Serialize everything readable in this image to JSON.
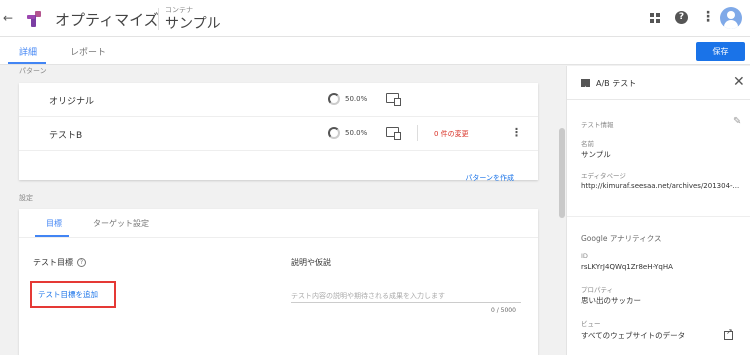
{
  "header": {
    "back_glyph": "←",
    "app_title": "オプティマイズ",
    "container_label": "コンテナ",
    "container_name": "サンプル"
  },
  "tabs": {
    "details": "詳細",
    "report": "レポート",
    "save": "保存"
  },
  "patterns": {
    "section_label": "パターン",
    "rows": [
      {
        "name": "オリジナル",
        "percent": "50.0%",
        "changes": ""
      },
      {
        "name": "テストB",
        "percent": "50.0%",
        "changes": "0 件の変更"
      }
    ],
    "create_link": "パターンを作成"
  },
  "settings": {
    "section_label": "設定",
    "tabs": [
      "目標",
      "ターゲット設定"
    ],
    "goal_heading": "テスト目標",
    "add_goal": "テスト目標を追加",
    "desc_heading": "説明や仮説",
    "desc_placeholder": "テスト内容の説明や期待される成果を入力します",
    "counter": "0 / 5000"
  },
  "side": {
    "title": "A/B テスト",
    "test_info_label": "テスト情報",
    "name_label": "名前",
    "name_value": "サンプル",
    "editor_label": "エディタページ",
    "editor_value": "http://kimuraf.seesaa.net/archives/201304-...",
    "ga_label": "Google アナリティクス",
    "id_label": "ID",
    "id_value": "rsLKYrJ4QWq1Zr8eH-YqHA",
    "property_label": "プロパティ",
    "property_value": "思い出のサッカー",
    "view_label": "ビュー",
    "view_value": "すべてのウェブサイトのデータ"
  },
  "colors": {
    "accent": "#4285f4",
    "primary_button": "#1a73e8",
    "changes_text": "#d93025",
    "highlight_box": "#e53935"
  },
  "icons": [
    "back-icon",
    "optimize-logo-icon",
    "apps-grid-icon",
    "help-icon",
    "more-vert-icon",
    "avatar-icon",
    "progress-ring-icon",
    "device-icon",
    "kebab-icon",
    "question-icon",
    "ab-test-icon",
    "close-icon",
    "edit-pencil-icon",
    "open-external-icon"
  ]
}
